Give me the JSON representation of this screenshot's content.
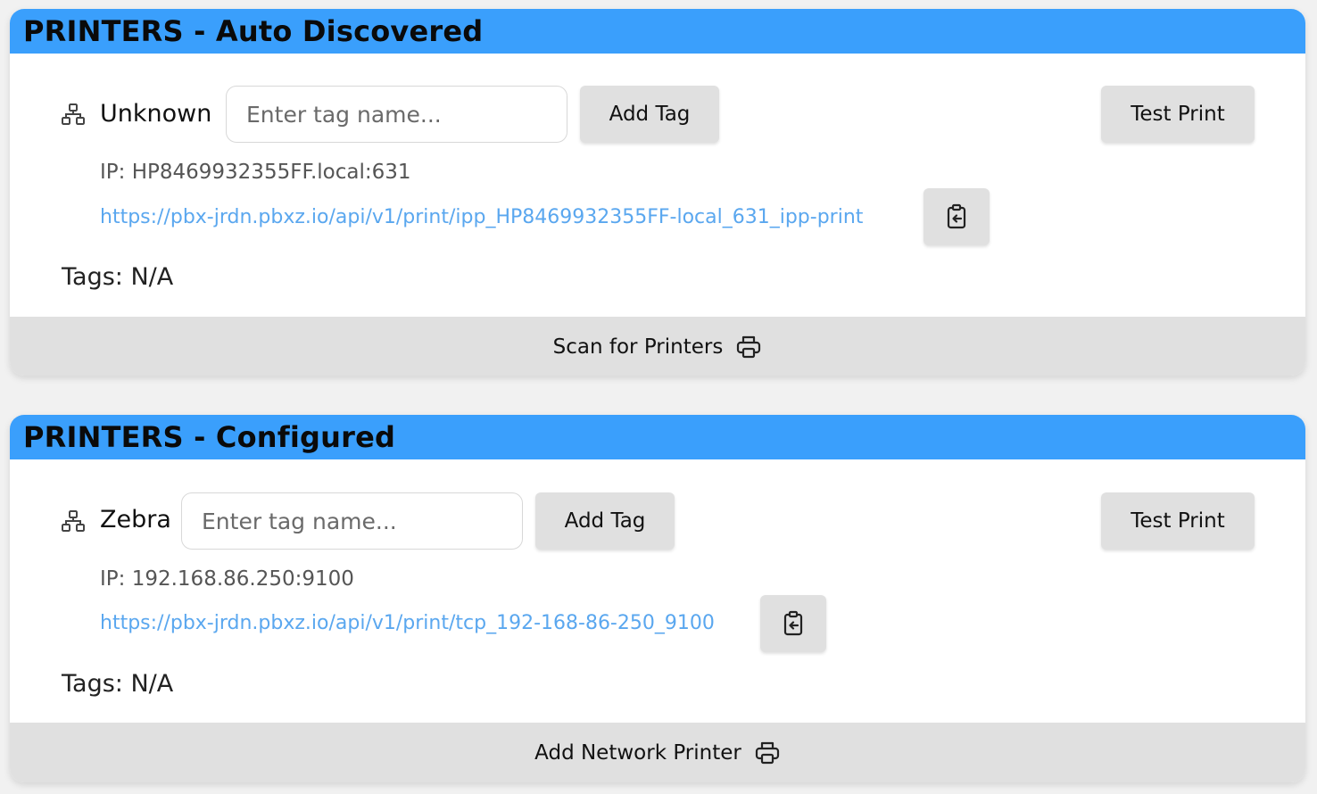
{
  "sections": [
    {
      "title": "PRINTERS - Auto Discovered",
      "printer": {
        "name": "Unknown",
        "tag_placeholder": "Enter tag name...",
        "add_tag_label": "Add Tag",
        "test_print_label": "Test Print",
        "ip_text": "IP: HP8469932355FF.local:631",
        "url": "https://pbx-jrdn.pbxz.io/api/v1/print/ipp_HP8469932355FF-local_631_ipp-print",
        "tags_label": "Tags:",
        "tags_value": "N/A"
      },
      "footer_label": "Scan for Printers"
    },
    {
      "title": "PRINTERS - Configured",
      "printer": {
        "name": "Zebra",
        "tag_placeholder": "Enter tag name...",
        "add_tag_label": "Add Tag",
        "test_print_label": "Test Print",
        "ip_text": "IP: 192.168.86.250:9100",
        "url": "https://pbx-jrdn.pbxz.io/api/v1/print/tcp_192-168-86-250_9100",
        "tags_label": "Tags:",
        "tags_value": "N/A"
      },
      "footer_label": "Add Network Printer"
    }
  ],
  "colors": {
    "header": "#3a9ffc",
    "link": "#5aa7ef",
    "button": "#e0e0e0",
    "page_bg": "#f1f1f1"
  },
  "icons": {
    "printer_type": "network-icon",
    "copy": "clipboard-copy-icon",
    "footer": "printer-icon"
  }
}
